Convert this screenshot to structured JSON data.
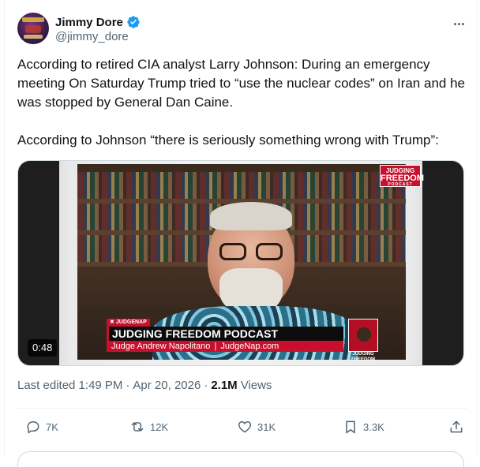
{
  "author": {
    "display_name": "Jimmy Dore",
    "handle": "@jimmy_dore",
    "avatar": "avatar-image",
    "verified_icon": "verified-badge-icon"
  },
  "more_icon": "more-options-icon",
  "tweet": {
    "paragraphs": [
      "According to retired CIA analyst Larry Johnson: During an emergency meeting On Saturday Trump tried to “use  the nuclear codes” on Iran and he was stopped by General Dan Caine.",
      "According to Johnson “there is seriously something wrong with Trump”:"
    ]
  },
  "video": {
    "duration": "0:48",
    "brand_line1": "JUDGING",
    "brand_line2": "FREEDOM",
    "brand_line3": "PODCAST",
    "lower_third": {
      "tag": "JUDGENAP",
      "title": "JUDGING FREEDOM PODCAST",
      "host": "Judge Andrew Napolitano",
      "separator": "|",
      "url": "JudgeNap.com",
      "logo_text_line1": "JUDGING",
      "logo_text_line2": "FREEDOM"
    }
  },
  "meta": {
    "edited": "Last edited 1:49 PM",
    "dot1": "·",
    "date": "Apr 20, 2026",
    "dot2": "·",
    "views_count": "2.1M",
    "views_label": "Views"
  },
  "actions": {
    "reply": {
      "icon": "reply-icon",
      "count": "7K"
    },
    "repost": {
      "icon": "repost-icon",
      "count": "12K"
    },
    "like": {
      "icon": "heart-icon",
      "count": "31K"
    },
    "bookmark": {
      "icon": "bookmark-icon",
      "count": "3.3K"
    },
    "share": {
      "icon": "share-icon"
    }
  },
  "colors": {
    "text_primary": "#0f1419",
    "text_secondary": "#536471",
    "verified_blue": "#1d9bf0",
    "border": "#eff3f4",
    "brand_red": "#c8102e"
  }
}
